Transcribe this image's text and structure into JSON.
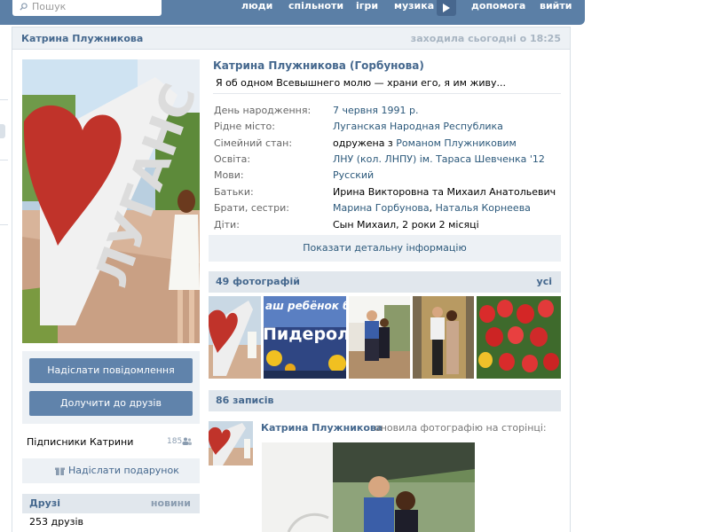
{
  "topbar": {
    "search_placeholder": "Пошук",
    "nav": [
      "люди",
      "спільноти",
      "ігри",
      "музика",
      "допомога",
      "вийти"
    ]
  },
  "profile": {
    "header_name": "Катрина Плужникова",
    "last_seen": "заходила сьогодні о 18:25",
    "full_name": "Катрина Плужникова (Горбунова)",
    "status": "Я об одном Всевышнего молю — храни его, я им живу...",
    "info": {
      "birthday": {
        "label": "День народження:",
        "value": "7 червня 1991 р."
      },
      "hometown": {
        "label": "Рідне місто:",
        "value": "Луганская Народная Республика"
      },
      "relationship": {
        "label": "Сімейний стан:",
        "prefix": "одружена з ",
        "value": "Романом Плужниковим"
      },
      "education": {
        "label": "Освіта:",
        "value": "ЛНУ (кол. ЛНПУ) ім. Тараса Шевченка '12"
      },
      "languages": {
        "label": "Мови:",
        "value": "Русский"
      },
      "parents": {
        "label": "Батьки:",
        "value": "Ирина Викторовна та Михаил Анатольевич"
      },
      "siblings": {
        "label": "Брати, сестри:",
        "value1": "Марина Горбунова",
        "sep": ", ",
        "value2": "Наталья Корнеева"
      },
      "children": {
        "label": "Діти:",
        "value": "Сын Михаил, 2 роки 2 місяці"
      }
    },
    "details_button": "Показати детальну інформацію"
  },
  "photos": {
    "title": "49 фотографій",
    "all_link": "усі",
    "thumb2_caption": "аш ребёнок буд",
    "thumb2_word": "Пидерол"
  },
  "sidebar": {
    "send_message": "Надіслати повідомлення",
    "add_friend": "Долучити до друзів",
    "followers_label": "Підписники Катрини",
    "followers_count": "185",
    "send_gift": "Надіслати подарунок",
    "friends_title": "Друзі",
    "friends_new": "новини",
    "friends_count": "253 друзів"
  },
  "wall": {
    "title": "86 записів",
    "post_author": "Катрина Плужникова",
    "post_action": "оновила фотографію на сторінці:"
  },
  "colors": {
    "brand_blue": "#5b7fa6",
    "link_blue": "#45688e",
    "button_blue": "#6083ab"
  }
}
